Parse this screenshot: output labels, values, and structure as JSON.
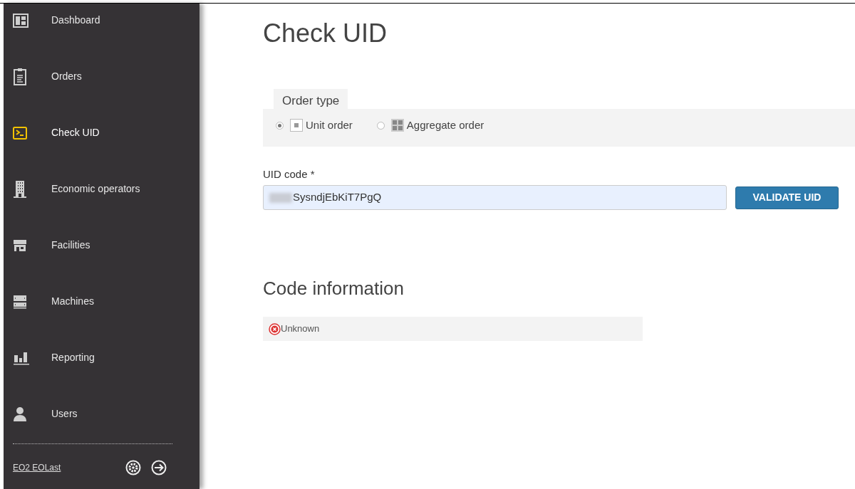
{
  "sidebar": {
    "items": [
      {
        "label": "Dashboard",
        "kind": "dashboard",
        "selected": false
      },
      {
        "label": "Orders",
        "kind": "clipboard",
        "selected": false
      },
      {
        "label": "Check UID",
        "kind": "terminal",
        "selected": true
      },
      {
        "label": "Economic operators",
        "kind": "building",
        "selected": false
      },
      {
        "label": "Facilities",
        "kind": "store",
        "selected": false
      },
      {
        "label": "Machines",
        "kind": "server",
        "selected": false
      },
      {
        "label": "Reporting",
        "kind": "chart",
        "selected": false
      },
      {
        "label": "Users",
        "kind": "user",
        "selected": false
      }
    ],
    "user": "EO2 EOLast"
  },
  "page": {
    "title": "Check UID",
    "order_type": {
      "legend": "Order type",
      "options": [
        {
          "label": "Unit order",
          "kind": "unit",
          "selected": true
        },
        {
          "label": "Aggregate order",
          "kind": "aggregate",
          "selected": false
        }
      ]
    },
    "uid": {
      "label": "UID code *",
      "value": "SysndjEbKiT7PgQ",
      "redacted": true
    },
    "validate_button": "VALIDATE UID",
    "code_information": {
      "title": "Code information",
      "status": "Unknown",
      "valid": false
    }
  }
}
